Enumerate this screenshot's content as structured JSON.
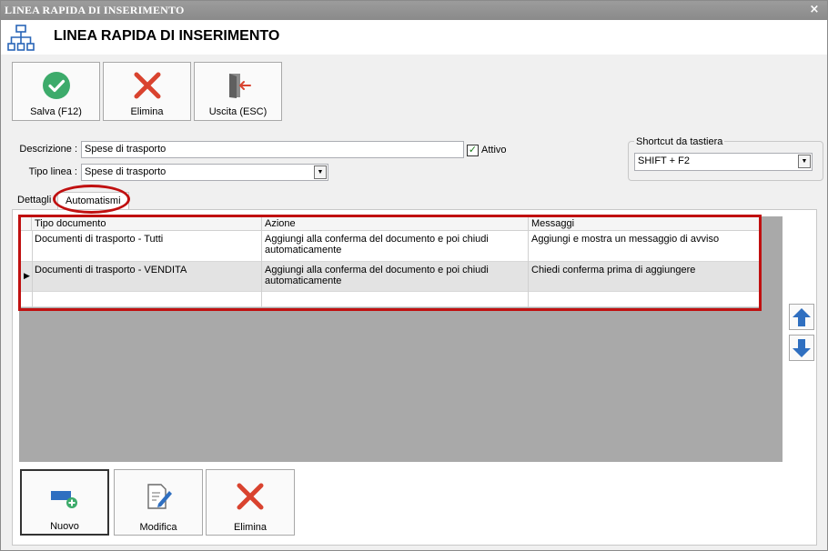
{
  "window": {
    "titlebar": "LINEA RAPIDA DI INSERIMENTO",
    "close_glyph": "×",
    "header_title": "LINEA RAPIDA DI INSERIMENTO",
    "header_icon": "network-structure-icon"
  },
  "toolbar": {
    "save_label": "Salva (F12)",
    "delete_label": "Elimina",
    "exit_label": "Uscita (ESC)"
  },
  "form": {
    "descrizione_label": "Descrizione :",
    "descrizione_value": "Spese di trasporto",
    "attivo_label": "Attivo",
    "attivo_checked": true,
    "tipo_linea_label": "Tipo linea :",
    "tipo_linea_value": "Spese di trasporto"
  },
  "shortcut": {
    "legend": "Shortcut da tastiera",
    "value": "SHIFT + F2"
  },
  "tabs": [
    {
      "label": "Dettagli",
      "active": false
    },
    {
      "label": "Automatismi",
      "active": true
    }
  ],
  "grid": {
    "columns": [
      "Tipo documento",
      "Azione",
      "Messaggi"
    ],
    "rows": [
      {
        "tipo": "Documenti di trasporto - Tutti",
        "azione": "Aggiungi alla conferma del documento e poi chiudi automaticamente",
        "messaggi": "Aggiungi e mostra un messaggio di avviso"
      },
      {
        "tipo": "Documenti di trasporto - VENDITA",
        "azione": "Aggiungi alla conferma del documento e poi chiudi automaticamente",
        "messaggi": "Chiedi conferma prima di aggiungere",
        "current": true
      },
      {
        "tipo": "",
        "azione": "",
        "messaggi": ""
      }
    ]
  },
  "bottom_buttons": {
    "new_label": "Nuovo",
    "edit_label": "Modifica",
    "delete_label": "Elimina"
  },
  "colors": {
    "highlight": "#c01010",
    "arrow_blue": "#2f6fc0",
    "ok_green": "#3dab6b",
    "delete_red": "#d9432f"
  }
}
